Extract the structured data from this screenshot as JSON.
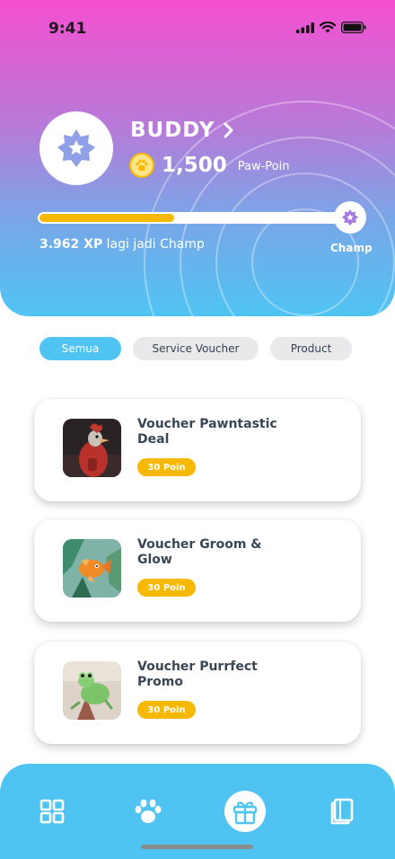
{
  "status_bar": {
    "time": "9:41"
  },
  "profile": {
    "rank_name": "BUDDY",
    "points_value": "1,500",
    "points_unit": "Paw-Poin",
    "progress_fraction": 0.44,
    "xp_amount": "3.962 XP",
    "xp_suffix": "lagi jadi Champ",
    "next_rank_label": "Champ"
  },
  "tabs": [
    {
      "label": "Semua",
      "active": true
    },
    {
      "label": "Service Voucher",
      "active": false
    },
    {
      "label": "Product",
      "active": false
    }
  ],
  "vouchers": [
    {
      "title": "Voucher Pawntastic Deal",
      "points": "30 Poin"
    },
    {
      "title": "Voucher Groom & Glow",
      "points": "30 Poin"
    },
    {
      "title": "Voucher Purrfect Promo",
      "points": "30 Poin"
    }
  ],
  "nav": [
    {
      "icon": "grid-icon",
      "active": false
    },
    {
      "icon": "paw-icon",
      "active": false
    },
    {
      "icon": "gift-icon",
      "active": true
    },
    {
      "icon": "book-icon",
      "active": false
    }
  ],
  "colors": {
    "accent": "#4fc4f3",
    "gold": "#f7b800",
    "gradient_top": "#f44fd0",
    "gradient_bottom": "#4fc4f3",
    "badge": "#8fa0e6"
  }
}
